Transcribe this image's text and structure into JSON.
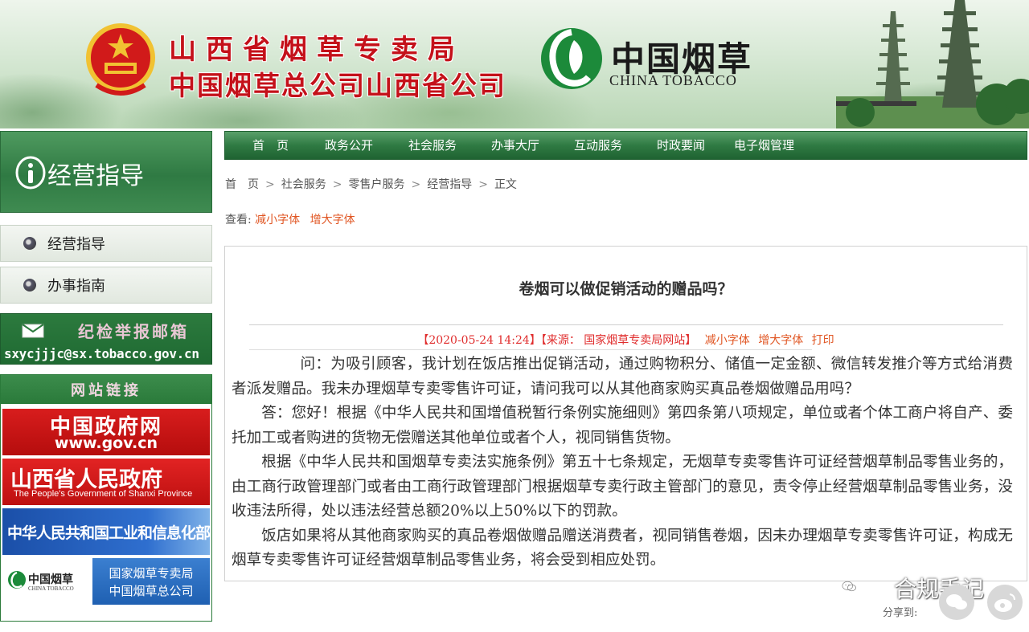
{
  "banner": {
    "title_line1": "山西省烟草专卖局",
    "title_line2": "中国烟草总公司山西省公司",
    "logo_cn": "中国烟草",
    "logo_en": "CHINA TOBACCO",
    "colors": {
      "title_red": "#c4111a",
      "green": "#2f7a43"
    }
  },
  "sidebar": {
    "header_title": "经营指导",
    "menu": [
      {
        "label": "经营指导"
      },
      {
        "label": "办事指南"
      }
    ],
    "report": {
      "title": "纪检举报邮箱",
      "email": "sxycjjjc@sx.tobacco.gov.cn"
    },
    "links": {
      "header": "网站链接",
      "gov": {
        "line1": "中国政府网",
        "line2": "www.gov.cn"
      },
      "shanxi": {
        "line1": "山西省人民政府",
        "line2": "The People's Government of Shanxi Province"
      },
      "miit": {
        "line1": "中华人民共和国工业和信息化部"
      },
      "tobacco": {
        "mini_cn": "中国烟草",
        "mini_en": "CHINA TOBACCO",
        "line1": "国家烟草专卖局",
        "line2": "中国烟草总公司"
      }
    }
  },
  "nav": {
    "items": [
      "首　页",
      "政务公开",
      "社会服务",
      "办事大厅",
      "互动服务",
      "时政要闻",
      "电子烟管理"
    ]
  },
  "breadcrumb": {
    "items": [
      "首　页",
      "社会服务",
      "零售户服务",
      "经营指导",
      "正文"
    ],
    "separator": ">"
  },
  "font_tools": {
    "prefix": "查看:",
    "smaller": "减小字体",
    "larger": "增大字体"
  },
  "article": {
    "title": "卷烟可以做促销活动的赠品吗？",
    "meta_prefix": "【2020-05-24 14:24】【来源：",
    "meta_source": " 国家烟草专卖局网站",
    "meta_suffix": "】",
    "meta_smaller": "减小字体",
    "meta_larger": "增大字体",
    "meta_print": "打印",
    "paragraphs": [
      "问：为吸引顾客，我计划在饭店推出促销活动，通过购物积分、储值一定金额、微信转发推介等方式给消费者派发赠品。我未办理烟草专卖零售许可证，请问我可以从其他商家购买真品卷烟做赠品用吗？",
      "答：您好！根据《中华人民共和国增值税暂行条例实施细则》第四条第八项规定，单位或者个体工商户将自产、委托加工或者购进的货物无偿赠送其他单位或者个人，视同销售货物。",
      "根据《中华人民共和国烟草专卖法实施条例》第五十七条规定，无烟草专卖零售许可证经营烟草制品零售业务的，由工商行政管理部门或者由工商行政管理部门根据烟草专卖行政主管部门的意见，责令停止经营烟草制品零售业务，没收违法所得，处以违法经营总额20%以上50%以下的罚款。",
      "饭店如果将从其他商家购买的真品卷烟做赠品赠送消费者，视同销售卷烟，因未办理烟草专卖零售许可证，构成无烟草专卖零售许可证经营烟草制品零售业务，将会受到相应处罚。"
    ]
  },
  "share": {
    "label": "分享到:",
    "watermark": "合规手记"
  }
}
